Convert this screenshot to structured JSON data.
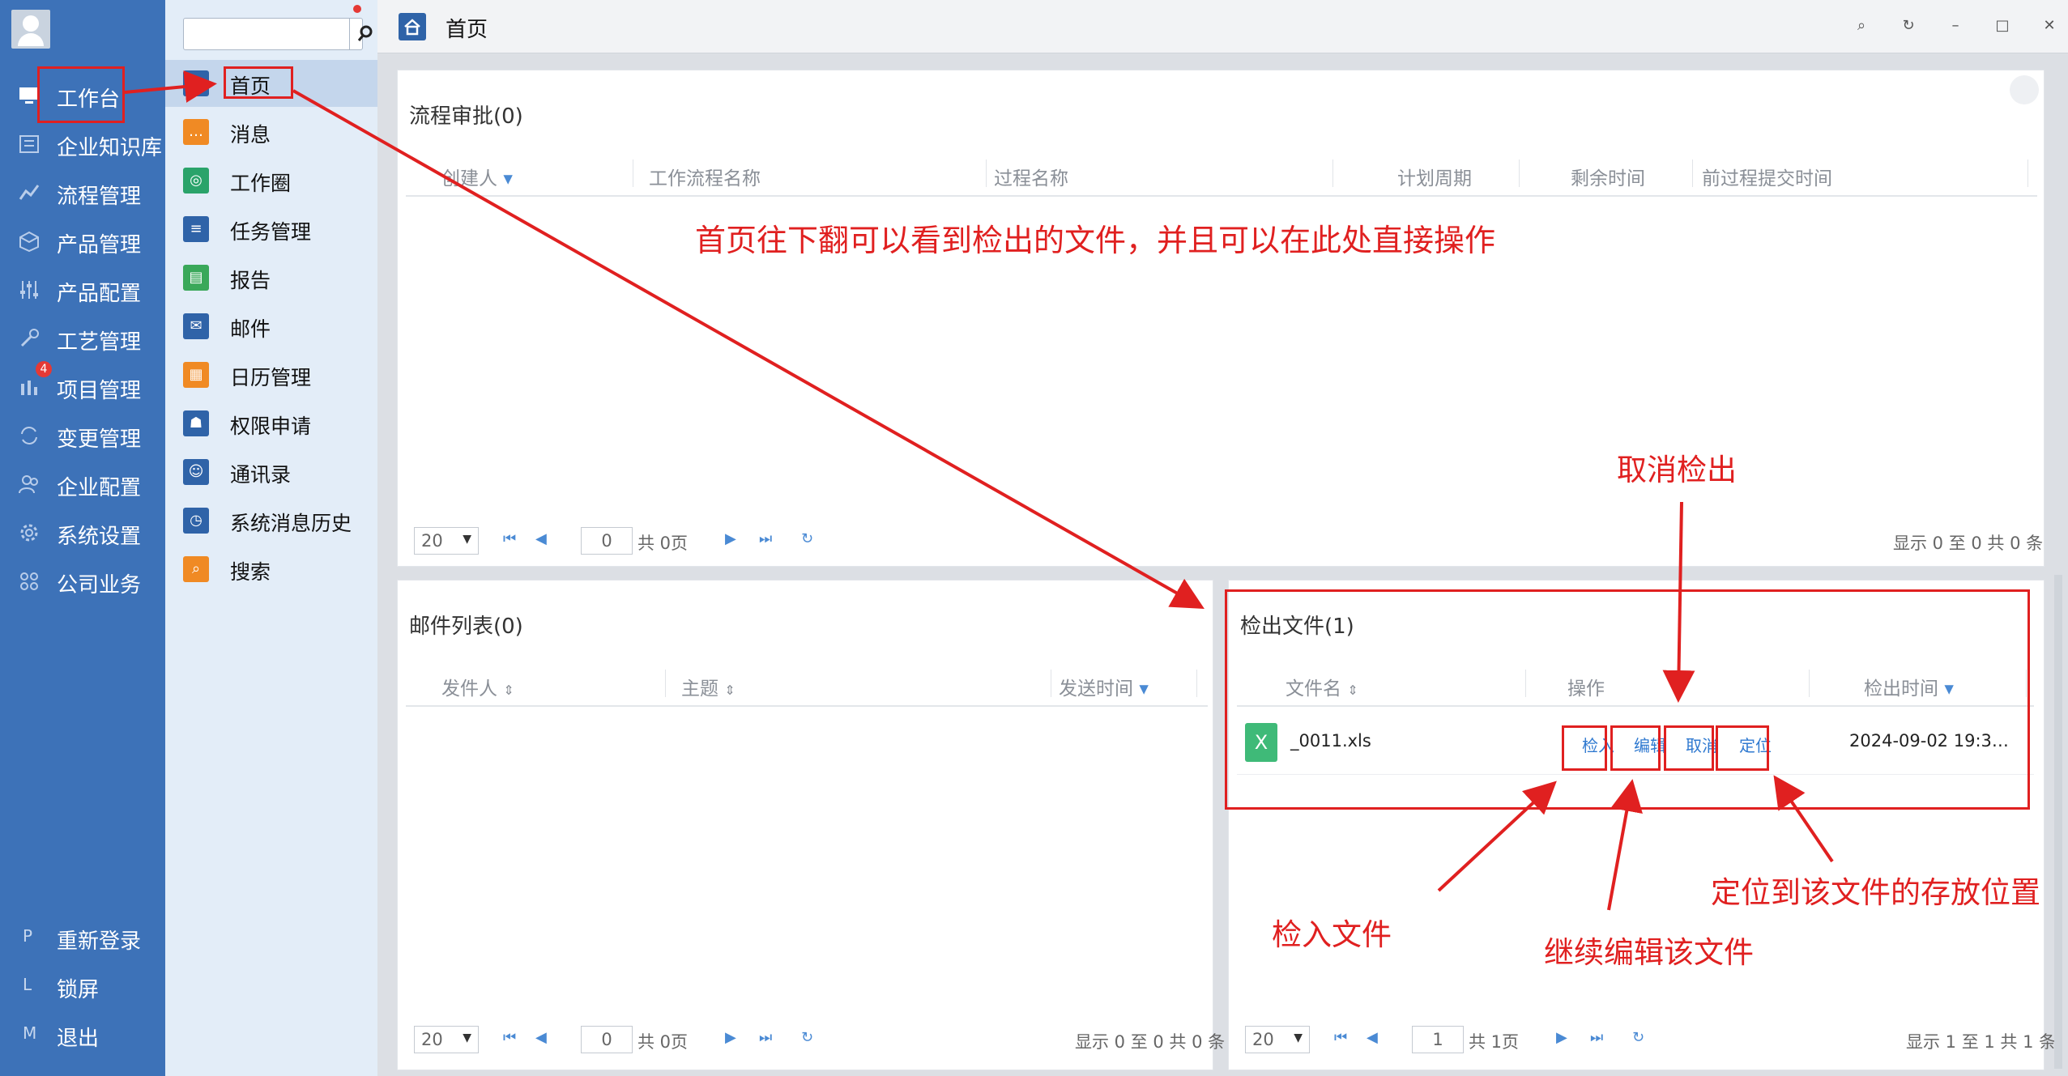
{
  "nav": {
    "items": [
      {
        "label": "工作台",
        "icon": "monitor-icon"
      },
      {
        "label": "企业知识库",
        "icon": "book-icon"
      },
      {
        "label": "流程管理",
        "icon": "flow-icon"
      },
      {
        "label": "产品管理",
        "icon": "cube-icon"
      },
      {
        "label": "产品配置",
        "icon": "sliders-icon"
      },
      {
        "label": "工艺管理",
        "icon": "wrench-icon"
      },
      {
        "label": "项目管理",
        "icon": "project-icon",
        "badge": "4"
      },
      {
        "label": "变更管理",
        "icon": "change-icon"
      },
      {
        "label": "企业配置",
        "icon": "users-icon"
      },
      {
        "label": "系统设置",
        "icon": "gear-icon"
      },
      {
        "label": "公司业务",
        "icon": "grid-icon"
      }
    ],
    "bottom": [
      {
        "key": "P",
        "label": "重新登录"
      },
      {
        "key": "L",
        "label": "锁屏"
      },
      {
        "key": "M",
        "label": "退出"
      }
    ]
  },
  "submenu": {
    "items": [
      {
        "label": "首页",
        "color": "#2f63a8"
      },
      {
        "label": "消息",
        "color": "#f08a24"
      },
      {
        "label": "工作圈",
        "color": "#2aa36a"
      },
      {
        "label": "任务管理",
        "color": "#2f63a8"
      },
      {
        "label": "报告",
        "color": "#3aa85a"
      },
      {
        "label": "邮件",
        "color": "#2f63a8"
      },
      {
        "label": "日历管理",
        "color": "#f08a24"
      },
      {
        "label": "权限申请",
        "color": "#2f63a8"
      },
      {
        "label": "通讯录",
        "color": "#2f63a8"
      },
      {
        "label": "系统消息历史",
        "color": "#2f63a8"
      },
      {
        "label": "搜索",
        "color": "#f08a24"
      }
    ]
  },
  "tab": {
    "title": "首页"
  },
  "workflow": {
    "title": "流程审批(0)",
    "columns": [
      "创建人",
      "工作流程名称",
      "过程名称",
      "计划周期",
      "剩余时间",
      "前过程提交时间"
    ],
    "pager": {
      "size": "20",
      "page": "0",
      "total": "共 0页",
      "info": "显示 0 至 0 共 0 条"
    }
  },
  "mail": {
    "title": "邮件列表(0)",
    "columns": [
      "发件人",
      "主题",
      "发送时间"
    ],
    "pager": {
      "size": "20",
      "page": "0",
      "total": "共 0页",
      "info": "显示 0 至 0 共 0 条"
    }
  },
  "checkout": {
    "title": "检出文件(1)",
    "columns": [
      "文件名",
      "操作",
      "检出时间"
    ],
    "rows": [
      {
        "file": "_0011.xls",
        "time": "2024-09-02 19:3…",
        "ops": [
          "检入",
          "编辑",
          "取消",
          "定位"
        ]
      }
    ],
    "pager": {
      "size": "20",
      "page": "1",
      "total": "共 1页",
      "info": "显示 1 至 1 共 1 条"
    }
  },
  "annotations": {
    "main": "首页往下翻可以看到检出的文件，并且可以在此处直接操作",
    "cancel": "取消检出",
    "checkin": "检入文件",
    "edit": "继续编辑该文件",
    "locate": "定位到该文件的存放位置"
  },
  "colors": {
    "nav_bg": "#3d72b8",
    "sub_bg": "#e3edf8",
    "annot": "#e02020",
    "link": "#2f79d0"
  }
}
